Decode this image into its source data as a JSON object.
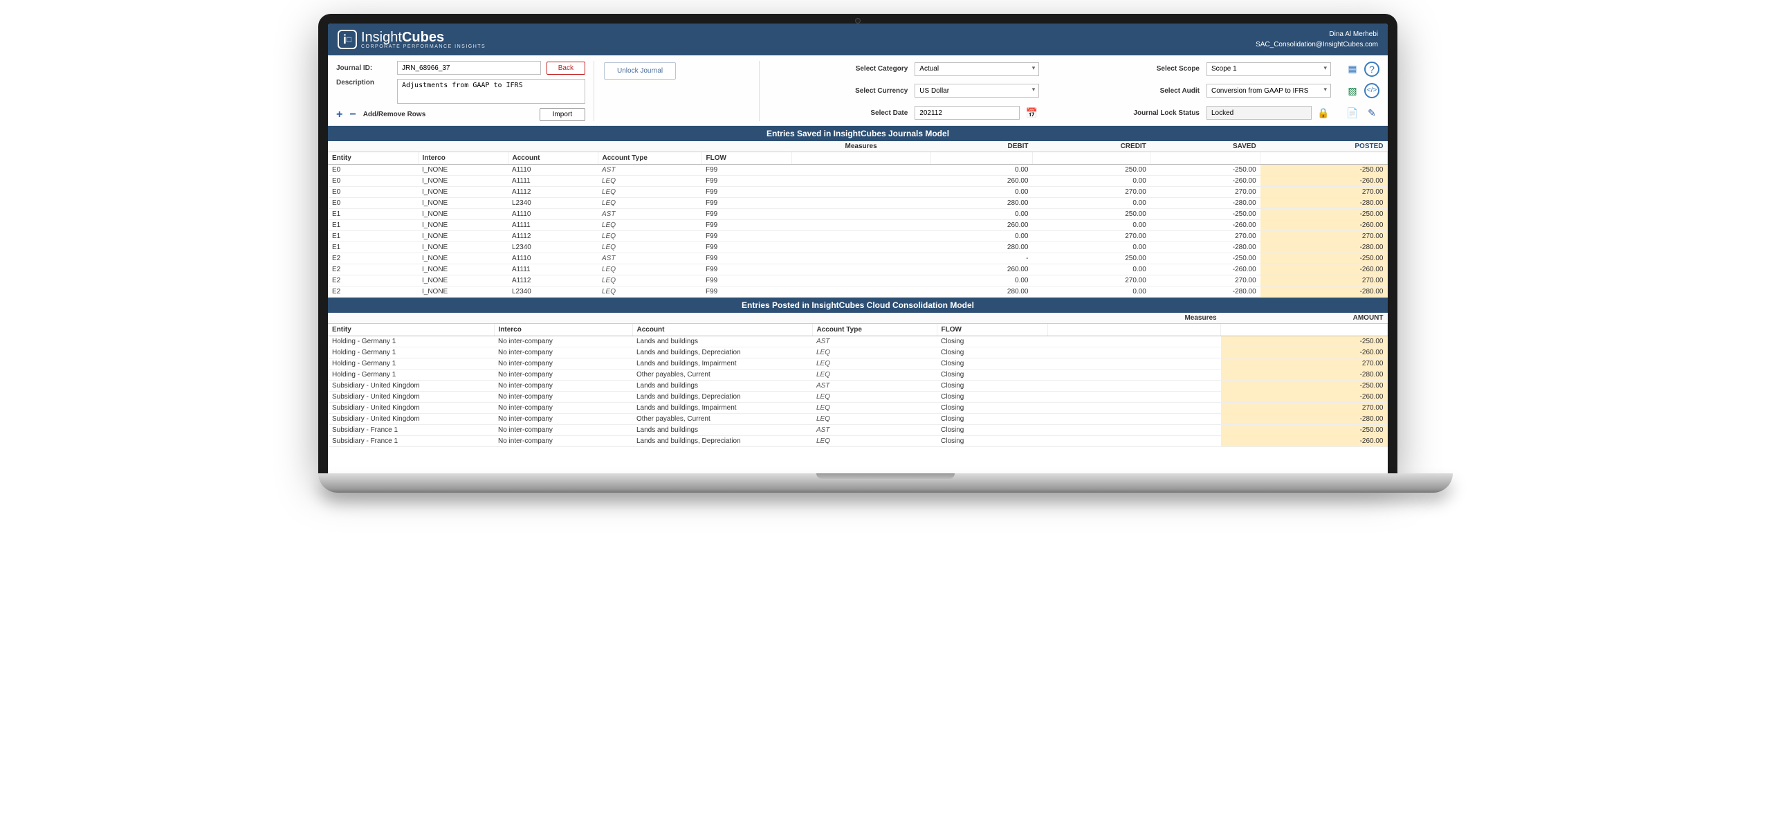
{
  "brand": {
    "name_prefix": "Insight",
    "name_bold": "Cubes",
    "tagline": "CORPORATE PERFORMANCE INSIGHTS"
  },
  "user": {
    "name": "Dina Al Merhebi",
    "email": "SAC_Consolidation@InsightCubes.com"
  },
  "form": {
    "journal_id_label": "Journal ID:",
    "journal_id": "JRN_68966_37",
    "back_label": "Back",
    "description_label": "Description",
    "description": "Adjustments from GAAP to IFRS",
    "unlock_label": "Unlock Journal",
    "addremove_label": "Add/Remove Rows",
    "import_label": "Import",
    "category_label": "Select Category",
    "category": "Actual",
    "currency_label": "Select Currency",
    "currency": "US Dollar",
    "date_label": "Select Date",
    "date": "202112",
    "scope_label": "Select Scope",
    "scope": "Scope 1",
    "audit_label": "Select Audit",
    "audit": "Conversion from GAAP to IFRS",
    "lock_label": "Journal Lock Status",
    "lock": "Locked"
  },
  "banner1": "Entries Saved in InsightCubes Journals Model",
  "banner2": "Entries Posted in InsightCubes Cloud Consolidation Model",
  "t1": {
    "measures": "Measures",
    "cols": {
      "entity": "Entity",
      "interco": "Interco",
      "account": "Account",
      "acct_type": "Account Type",
      "flow": "FLOW",
      "debit": "DEBIT",
      "credit": "CREDIT",
      "saved": "SAVED",
      "posted": "POSTED"
    },
    "rows": [
      {
        "entity": "E0",
        "interco": "I_NONE",
        "account": "A1110",
        "at": "AST",
        "flow": "F99",
        "debit": "0.00",
        "credit": "250.00",
        "saved": "-250.00",
        "posted": "-250.00"
      },
      {
        "entity": "E0",
        "interco": "I_NONE",
        "account": "A1111",
        "at": "LEQ",
        "flow": "F99",
        "debit": "260.00",
        "credit": "0.00",
        "saved": "-260.00",
        "posted": "-260.00"
      },
      {
        "entity": "E0",
        "interco": "I_NONE",
        "account": "A1112",
        "at": "LEQ",
        "flow": "F99",
        "debit": "0.00",
        "credit": "270.00",
        "saved": "270.00",
        "posted": "270.00"
      },
      {
        "entity": "E0",
        "interco": "I_NONE",
        "account": "L2340",
        "at": "LEQ",
        "flow": "F99",
        "debit": "280.00",
        "credit": "0.00",
        "saved": "-280.00",
        "posted": "-280.00"
      },
      {
        "entity": "E1",
        "interco": "I_NONE",
        "account": "A1110",
        "at": "AST",
        "flow": "F99",
        "debit": "0.00",
        "credit": "250.00",
        "saved": "-250.00",
        "posted": "-250.00"
      },
      {
        "entity": "E1",
        "interco": "I_NONE",
        "account": "A1111",
        "at": "LEQ",
        "flow": "F99",
        "debit": "260.00",
        "credit": "0.00",
        "saved": "-260.00",
        "posted": "-260.00"
      },
      {
        "entity": "E1",
        "interco": "I_NONE",
        "account": "A1112",
        "at": "LEQ",
        "flow": "F99",
        "debit": "0.00",
        "credit": "270.00",
        "saved": "270.00",
        "posted": "270.00"
      },
      {
        "entity": "E1",
        "interco": "I_NONE",
        "account": "L2340",
        "at": "LEQ",
        "flow": "F99",
        "debit": "280.00",
        "credit": "0.00",
        "saved": "-280.00",
        "posted": "-280.00"
      },
      {
        "entity": "E2",
        "interco": "I_NONE",
        "account": "A1110",
        "at": "AST",
        "flow": "F99",
        "debit": "-",
        "credit": "250.00",
        "saved": "-250.00",
        "posted": "-250.00"
      },
      {
        "entity": "E2",
        "interco": "I_NONE",
        "account": "A1111",
        "at": "LEQ",
        "flow": "F99",
        "debit": "260.00",
        "credit": "0.00",
        "saved": "-260.00",
        "posted": "-260.00"
      },
      {
        "entity": "E2",
        "interco": "I_NONE",
        "account": "A1112",
        "at": "LEQ",
        "flow": "F99",
        "debit": "0.00",
        "credit": "270.00",
        "saved": "270.00",
        "posted": "270.00"
      },
      {
        "entity": "E2",
        "interco": "I_NONE",
        "account": "L2340",
        "at": "LEQ",
        "flow": "F99",
        "debit": "280.00",
        "credit": "0.00",
        "saved": "-280.00",
        "posted": "-280.00"
      }
    ]
  },
  "t2": {
    "measures": "Measures",
    "cols": {
      "entity": "Entity",
      "interco": "Interco",
      "account": "Account",
      "acct_type": "Account Type",
      "flow": "FLOW",
      "amount": "AMOUNT"
    },
    "rows": [
      {
        "entity": "Holding - Germany 1",
        "interco": "No inter-company",
        "account": "Lands and buildings",
        "at": "AST",
        "flow": "Closing",
        "amount": "-250.00"
      },
      {
        "entity": "Holding - Germany 1",
        "interco": "No inter-company",
        "account": "Lands and buildings, Depreciation",
        "at": "LEQ",
        "flow": "Closing",
        "amount": "-260.00"
      },
      {
        "entity": "Holding - Germany 1",
        "interco": "No inter-company",
        "account": "Lands and buildings, Impairment",
        "at": "LEQ",
        "flow": "Closing",
        "amount": "270.00"
      },
      {
        "entity": "Holding - Germany 1",
        "interco": "No inter-company",
        "account": "Other payables, Current",
        "at": "LEQ",
        "flow": "Closing",
        "amount": "-280.00"
      },
      {
        "entity": "Subsidiary - United Kingdom",
        "interco": "No inter-company",
        "account": "Lands and buildings",
        "at": "AST",
        "flow": "Closing",
        "amount": "-250.00"
      },
      {
        "entity": "Subsidiary - United Kingdom",
        "interco": "No inter-company",
        "account": "Lands and buildings, Depreciation",
        "at": "LEQ",
        "flow": "Closing",
        "amount": "-260.00"
      },
      {
        "entity": "Subsidiary - United Kingdom",
        "interco": "No inter-company",
        "account": "Lands and buildings, Impairment",
        "at": "LEQ",
        "flow": "Closing",
        "amount": "270.00"
      },
      {
        "entity": "Subsidiary - United Kingdom",
        "interco": "No inter-company",
        "account": "Other payables, Current",
        "at": "LEQ",
        "flow": "Closing",
        "amount": "-280.00"
      },
      {
        "entity": "Subsidiary - France 1",
        "interco": "No inter-company",
        "account": "Lands and buildings",
        "at": "AST",
        "flow": "Closing",
        "amount": "-250.00"
      },
      {
        "entity": "Subsidiary - France 1",
        "interco": "No inter-company",
        "account": "Lands and buildings, Depreciation",
        "at": "LEQ",
        "flow": "Closing",
        "amount": "-260.00"
      }
    ]
  }
}
